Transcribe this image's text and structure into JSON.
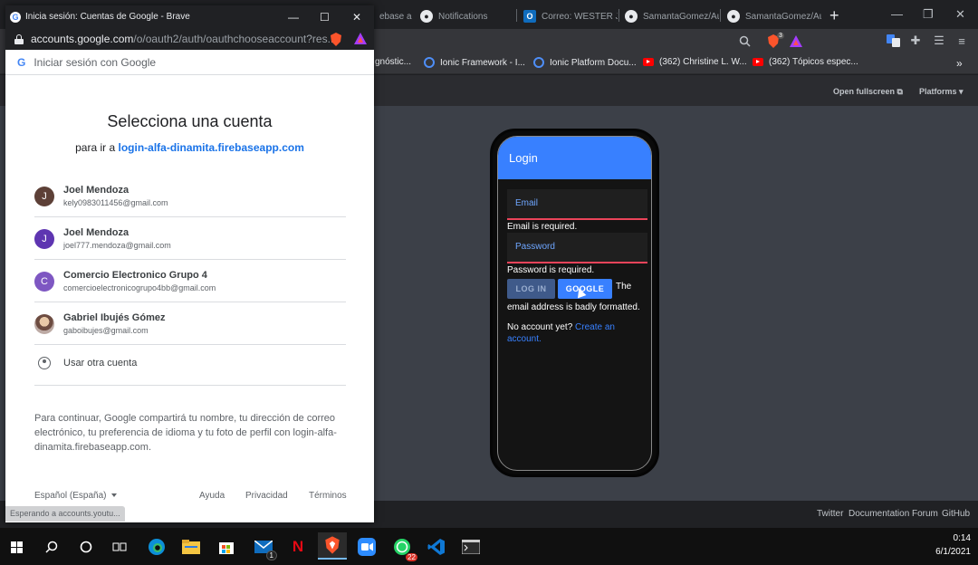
{
  "browser": {
    "tabs": [
      {
        "label": "ebase al p",
        "icon": "firebase-icon"
      },
      {
        "label": "Notifications",
        "icon": "github-icon"
      },
      {
        "label": "Correo: WESTER JO",
        "icon": "outlook-icon"
      },
      {
        "label": "SamantaGomez/Aut",
        "icon": "github-icon"
      },
      {
        "label": "SamantaGomez/Aut",
        "icon": "github-icon"
      }
    ],
    "new_tab": "+",
    "shield_count": "3",
    "bookmarks": [
      {
        "label": "gnóstic...",
        "icon": "ionic-icon"
      },
      {
        "label": "Ionic Framework - I...",
        "icon": "ionic-icon"
      },
      {
        "label": "Ionic Platform Docu...",
        "icon": "ionic-icon"
      },
      {
        "label": "(362) Christine L. W...",
        "icon": "youtube-icon"
      },
      {
        "label": "(362) Tópicos espec...",
        "icon": "youtube-icon"
      }
    ],
    "more_bookmarks": "»",
    "open_fullscreen": "Open fullscreen",
    "platforms": "Platforms",
    "footer_links": [
      "Twitter",
      "Documentation",
      "Forum",
      "GitHub"
    ]
  },
  "phone": {
    "header_title": "Login",
    "email_placeholder": "Email",
    "email_error": "Email is required.",
    "password_placeholder": "Password",
    "password_error": "Password is required.",
    "login_button": "LOG IN",
    "google_button": "GOOGLE",
    "format_error_1": "The",
    "format_error_2": "email address is badly formatted.",
    "no_account": "No account yet?",
    "create_account": "Create an account."
  },
  "popup": {
    "window_title": "Inicia sesión: Cuentas de Google - Brave",
    "url_host": "accounts.google.com",
    "url_path": "/o/oauth2/auth/oauthchooseaccount?res...",
    "google_bar": "Iniciar sesión con Google",
    "heading": "Selecciona una cuenta",
    "subtitle_prefix": "para ir a",
    "subtitle_site": "login-alfa-dinamita.firebaseapp.com",
    "accounts": [
      {
        "initial": "J",
        "name": "Joel Mendoza",
        "email": "kely0983011456@gmail.com",
        "color": "#5d4037"
      },
      {
        "initial": "J",
        "name": "Joel Mendoza",
        "email": "joel777.mendoza@gmail.com",
        "color": "#5e35b1"
      },
      {
        "initial": "C",
        "name": "Comercio Electronico Grupo 4",
        "email": "comercioelectronicogrupo4bb@gmail.com",
        "color": "#7e57c2"
      },
      {
        "initial": "",
        "name": "Gabriel Ibujés Gómez",
        "email": "gaboibujes@gmail.com",
        "color": "#a1887f"
      }
    ],
    "other_account": "Usar otra cuenta",
    "notice": "Para continuar, Google compartirá tu nombre, tu dirección de correo electrónico, tu preferencia de idioma y tu foto de perfil con login-alfa-dinamita.firebaseapp.com.",
    "language": "Español (España)",
    "help": "Ayuda",
    "privacy": "Privacidad",
    "terms": "Términos",
    "status": "Esperando a accounts.youtu..."
  },
  "taskbar": {
    "mail_badge": "1",
    "whatsapp_badge": "22",
    "time": "0:14",
    "date": "6/1/2021"
  },
  "colors": {
    "ionic_primary": "#3880ff",
    "google_blue": "#1a73e8",
    "error_red": "#eb445a"
  }
}
